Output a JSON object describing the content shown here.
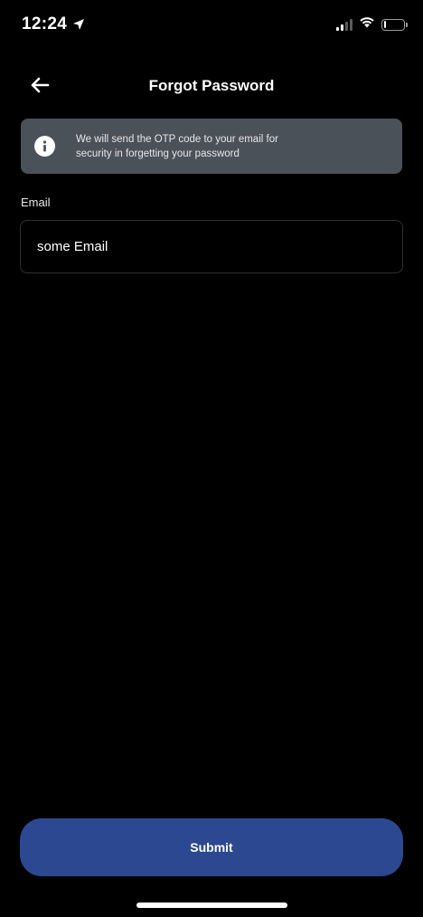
{
  "status_bar": {
    "time": "12:24",
    "location_icon": "location-arrow-icon",
    "signal_icon": "cellular-signal-icon",
    "wifi_icon": "wifi-icon",
    "battery_icon": "battery-low-icon"
  },
  "header": {
    "back_icon": "arrow-left-icon",
    "title": "Forgot Password"
  },
  "info_banner": {
    "icon": "info-icon",
    "text_line1": "We will send the OTP code to your email for",
    "text_line2": "security in forgetting your password"
  },
  "form": {
    "email_label": "Email",
    "email_value": "some Email"
  },
  "actions": {
    "submit_label": "Submit"
  },
  "colors": {
    "background": "#000000",
    "banner": "#4b5158",
    "primary": "#2c4890",
    "input_border": "#2f2f2f"
  }
}
